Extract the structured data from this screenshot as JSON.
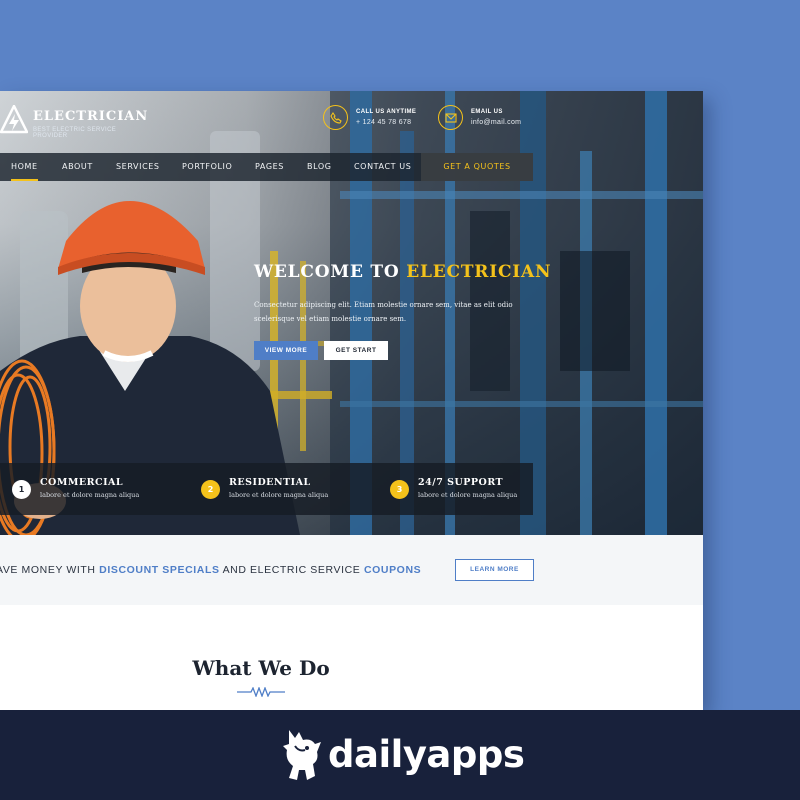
{
  "site": {
    "logo_title": "ELECTRICIAN",
    "logo_tagline": "BEST ELECTRIC SERVICE PROVIDER",
    "contacts": [
      {
        "icon": "phone-icon",
        "label": "CALL US ANYTIME",
        "value": "+ 124 45 78 678"
      },
      {
        "icon": "mail-icon",
        "label": "EMAIL US",
        "value": "info@mail.com"
      }
    ],
    "nav": {
      "items": [
        "HOME",
        "ABOUT",
        "SERVICES",
        "PORTFOLIO",
        "PAGES",
        "BLOG",
        "CONTACT US"
      ],
      "active": "HOME",
      "cta": "GET A QUOTES"
    },
    "hero": {
      "title_prefix": "WELCOME TO",
      "title_highlight": "ELECTRICIAN",
      "text": "Consectetur adipiscing elit. Etiam molestie ornare sem, vitae as elit odio scelerisque vel etiam molestie ornare sem.",
      "primary_button": "VIEW MORE",
      "secondary_button": "GET START"
    },
    "features": [
      {
        "number": "1",
        "title": "COMMERCIAL",
        "desc": "labore et dolore magna aliqua"
      },
      {
        "number": "2",
        "title": "RESIDENTIAL",
        "desc": "labore et dolore magna aliqua"
      },
      {
        "number": "3",
        "title": "24/7 SUPPORT",
        "desc": "labore et dolore magna aliqua"
      }
    ],
    "promo": {
      "part1": "AVE MONEY WITH",
      "hl1": "DISCOUNT SPECIALS",
      "part2": "AND ELECTRIC SERVICE",
      "hl2": "COUPONS",
      "button": "LEARN MORE"
    },
    "section_title": "What We Do"
  },
  "brand": {
    "name": "dailyapps",
    "icon": "rhino-logo-icon"
  },
  "colors": {
    "background": "#5b83c6",
    "accent_yellow": "#f4c21b",
    "accent_blue": "#4f7ec7",
    "brand_bar": "#18213b"
  }
}
